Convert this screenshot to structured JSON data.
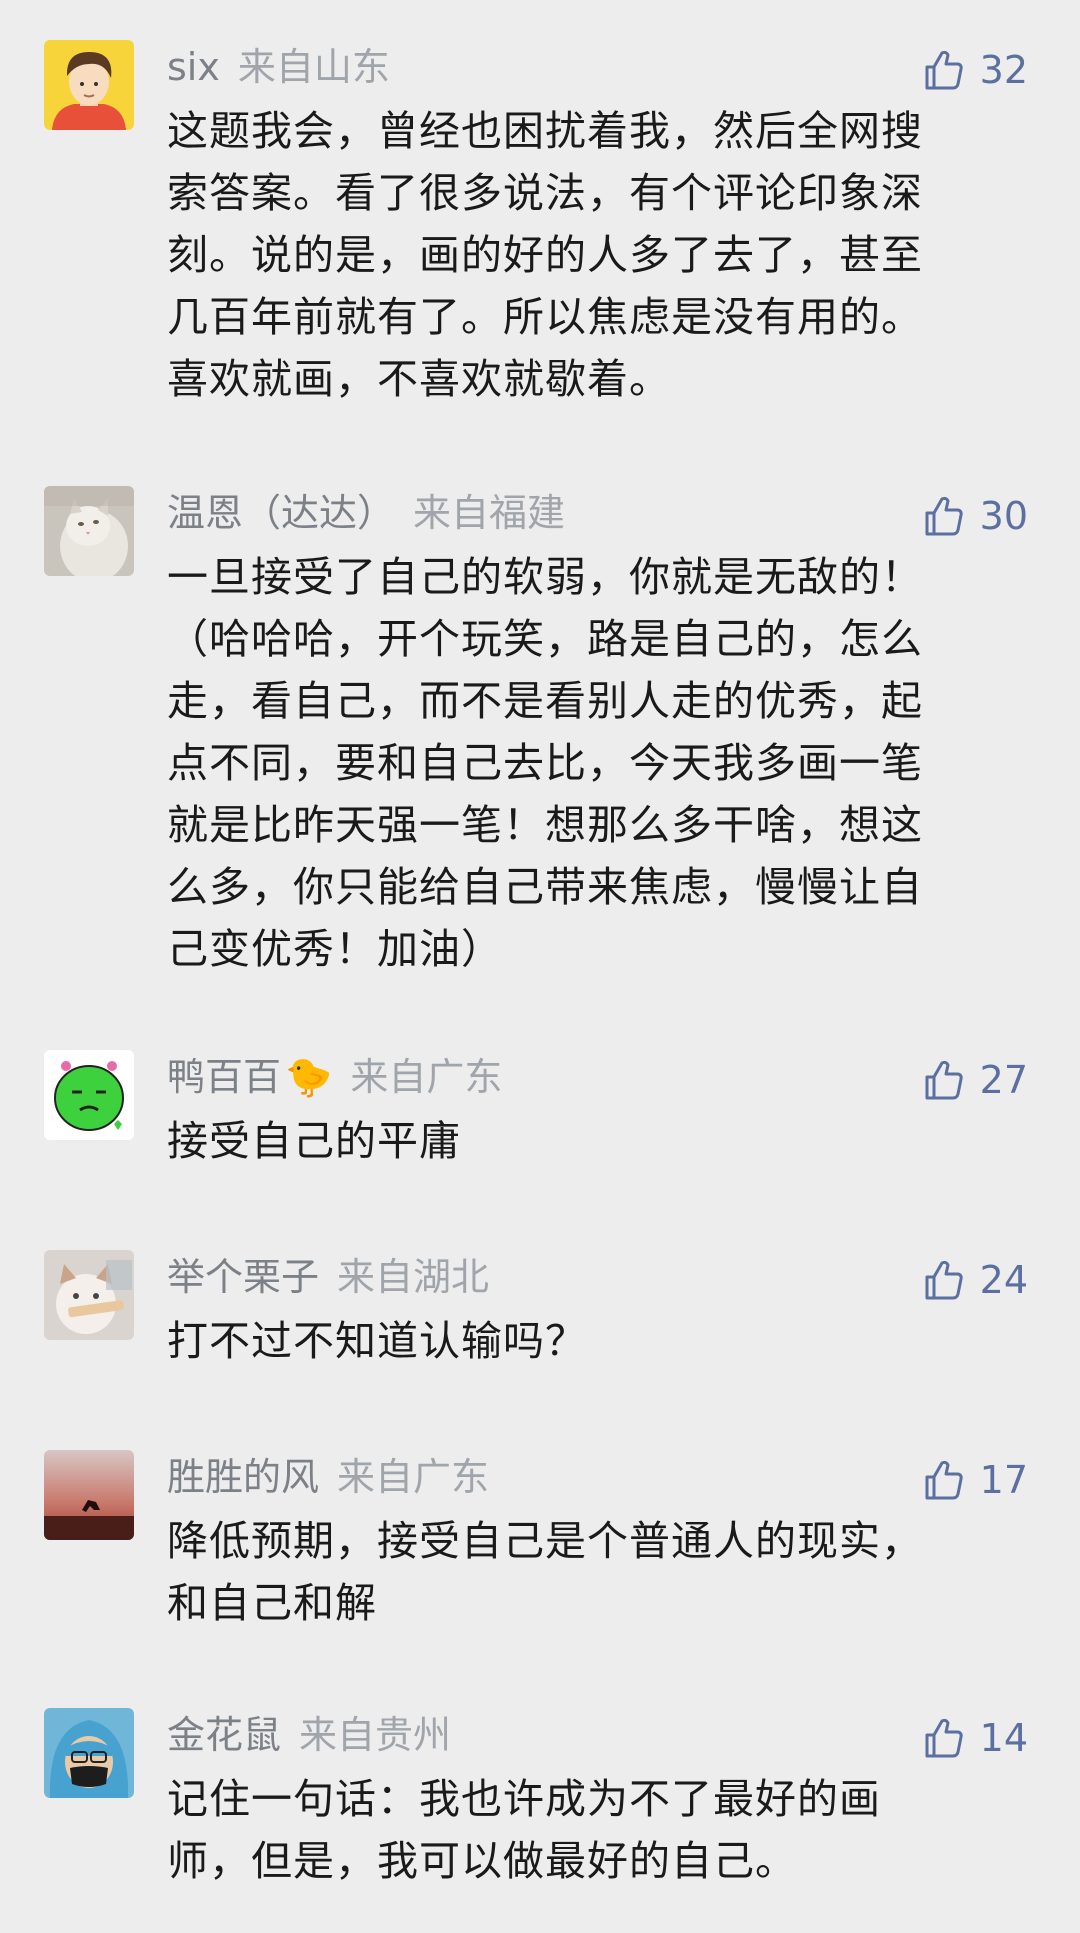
{
  "comments": [
    {
      "user": "six",
      "location": "来自山东",
      "likes": "32",
      "lines": [
        "这题我会，曾经也困扰着我，然后全网搜",
        "索答案。看了很多说法，有个评论印象深",
        "刻。说的是，画的好的人多了去了，甚至",
        "几百年前就有了。所以焦虑是没有用的。",
        "喜欢就画，不喜欢就歇着。"
      ]
    },
    {
      "user": "温恩（达达）",
      "location": "来自福建",
      "likes": "30",
      "lines": [
        "一旦接受了自己的软弱，你就是无敌的！",
        "（哈哈哈，开个玩笑，路是自己的，怎么",
        "走，看自己，而不是看别人走的优秀，起",
        "点不同，要和自己去比，今天我多画一笔",
        "就是比昨天强一笔！想那么多干啥，想这",
        "么多，你只能给自己带来焦虑，慢慢让自",
        "己变优秀！加油）"
      ]
    },
    {
      "user": "鸭百百",
      "emoji": "🐤",
      "location": "来自广东",
      "likes": "27",
      "lines": [
        "接受自己的平庸"
      ]
    },
    {
      "user": "举个栗子",
      "location": "来自湖北",
      "likes": "24",
      "lines": [
        "打不过不知道认输吗？"
      ]
    },
    {
      "user": "胜胜的风",
      "location": "来自广东",
      "likes": "17",
      "lines": [
        "降低预期，接受自己是个普通人的现实，",
        "和自己和解"
      ]
    },
    {
      "user": "金花鼠",
      "location": "来自贵州",
      "likes": "14",
      "lines": [
        "记住一句话：我也许成为不了最好的画",
        "师，但是，我可以做最好的自己。"
      ]
    }
  ],
  "icons": {
    "like": "thumbs-up-icon"
  },
  "colors": {
    "background": "#ededed",
    "likes": "#5c6fa1",
    "meta": "#8a8f96",
    "text": "#1a1a1a"
  }
}
